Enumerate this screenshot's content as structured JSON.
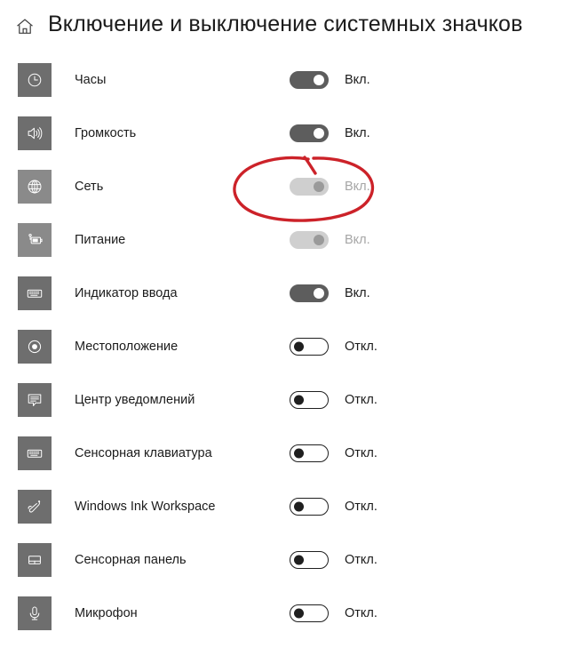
{
  "header": {
    "home_icon": "home-icon",
    "title": "Включение и выключение системных значков"
  },
  "colors": {
    "icon_tile_bg": "#6e6e6e",
    "toggle_on_bg": "#5d5d5d",
    "toggle_off_border": "#1f1f1f",
    "toggle_disabled_bg": "#cfcfcf",
    "annotation_red": "#cc2229",
    "text": "#1b1b1b",
    "text_muted": "#a6a6a6"
  },
  "state_labels": {
    "on": "Вкл.",
    "off": "Откл."
  },
  "rows": [
    {
      "icon": "clock-icon",
      "label": "Часы",
      "state": "Вкл.",
      "toggle": "on",
      "enabled": true
    },
    {
      "icon": "volume-icon",
      "label": "Громкость",
      "state": "Вкл.",
      "toggle": "on",
      "enabled": true
    },
    {
      "icon": "network-globe-icon",
      "label": "Сеть",
      "state": "Вкл.",
      "toggle": "disabled",
      "enabled": false
    },
    {
      "icon": "battery-power-icon",
      "label": "Питание",
      "state": "Вкл.",
      "toggle": "disabled",
      "enabled": false
    },
    {
      "icon": "keyboard-icon",
      "label": "Индикатор ввода",
      "state": "Вкл.",
      "toggle": "on",
      "enabled": true
    },
    {
      "icon": "location-icon",
      "label": "Местоположение",
      "state": "Откл.",
      "toggle": "off",
      "enabled": true
    },
    {
      "icon": "action-center-icon",
      "label": "Центр уведомлений",
      "state": "Откл.",
      "toggle": "off",
      "enabled": true
    },
    {
      "icon": "touch-keyboard-icon",
      "label": "Сенсорная клавиатура",
      "state": "Откл.",
      "toggle": "off",
      "enabled": true
    },
    {
      "icon": "windows-ink-pen-icon",
      "label": "Windows Ink Workspace",
      "state": "Откл.",
      "toggle": "off",
      "enabled": true
    },
    {
      "icon": "touchpad-icon",
      "label": "Сенсорная панель",
      "state": "Откл.",
      "toggle": "off",
      "enabled": true
    },
    {
      "icon": "microphone-icon",
      "label": "Микрофон",
      "state": "Откл.",
      "toggle": "off",
      "enabled": true
    }
  ],
  "annotation": {
    "shape": "hand-drawn-red-ellipse-with-arrow",
    "target": "Сеть"
  }
}
